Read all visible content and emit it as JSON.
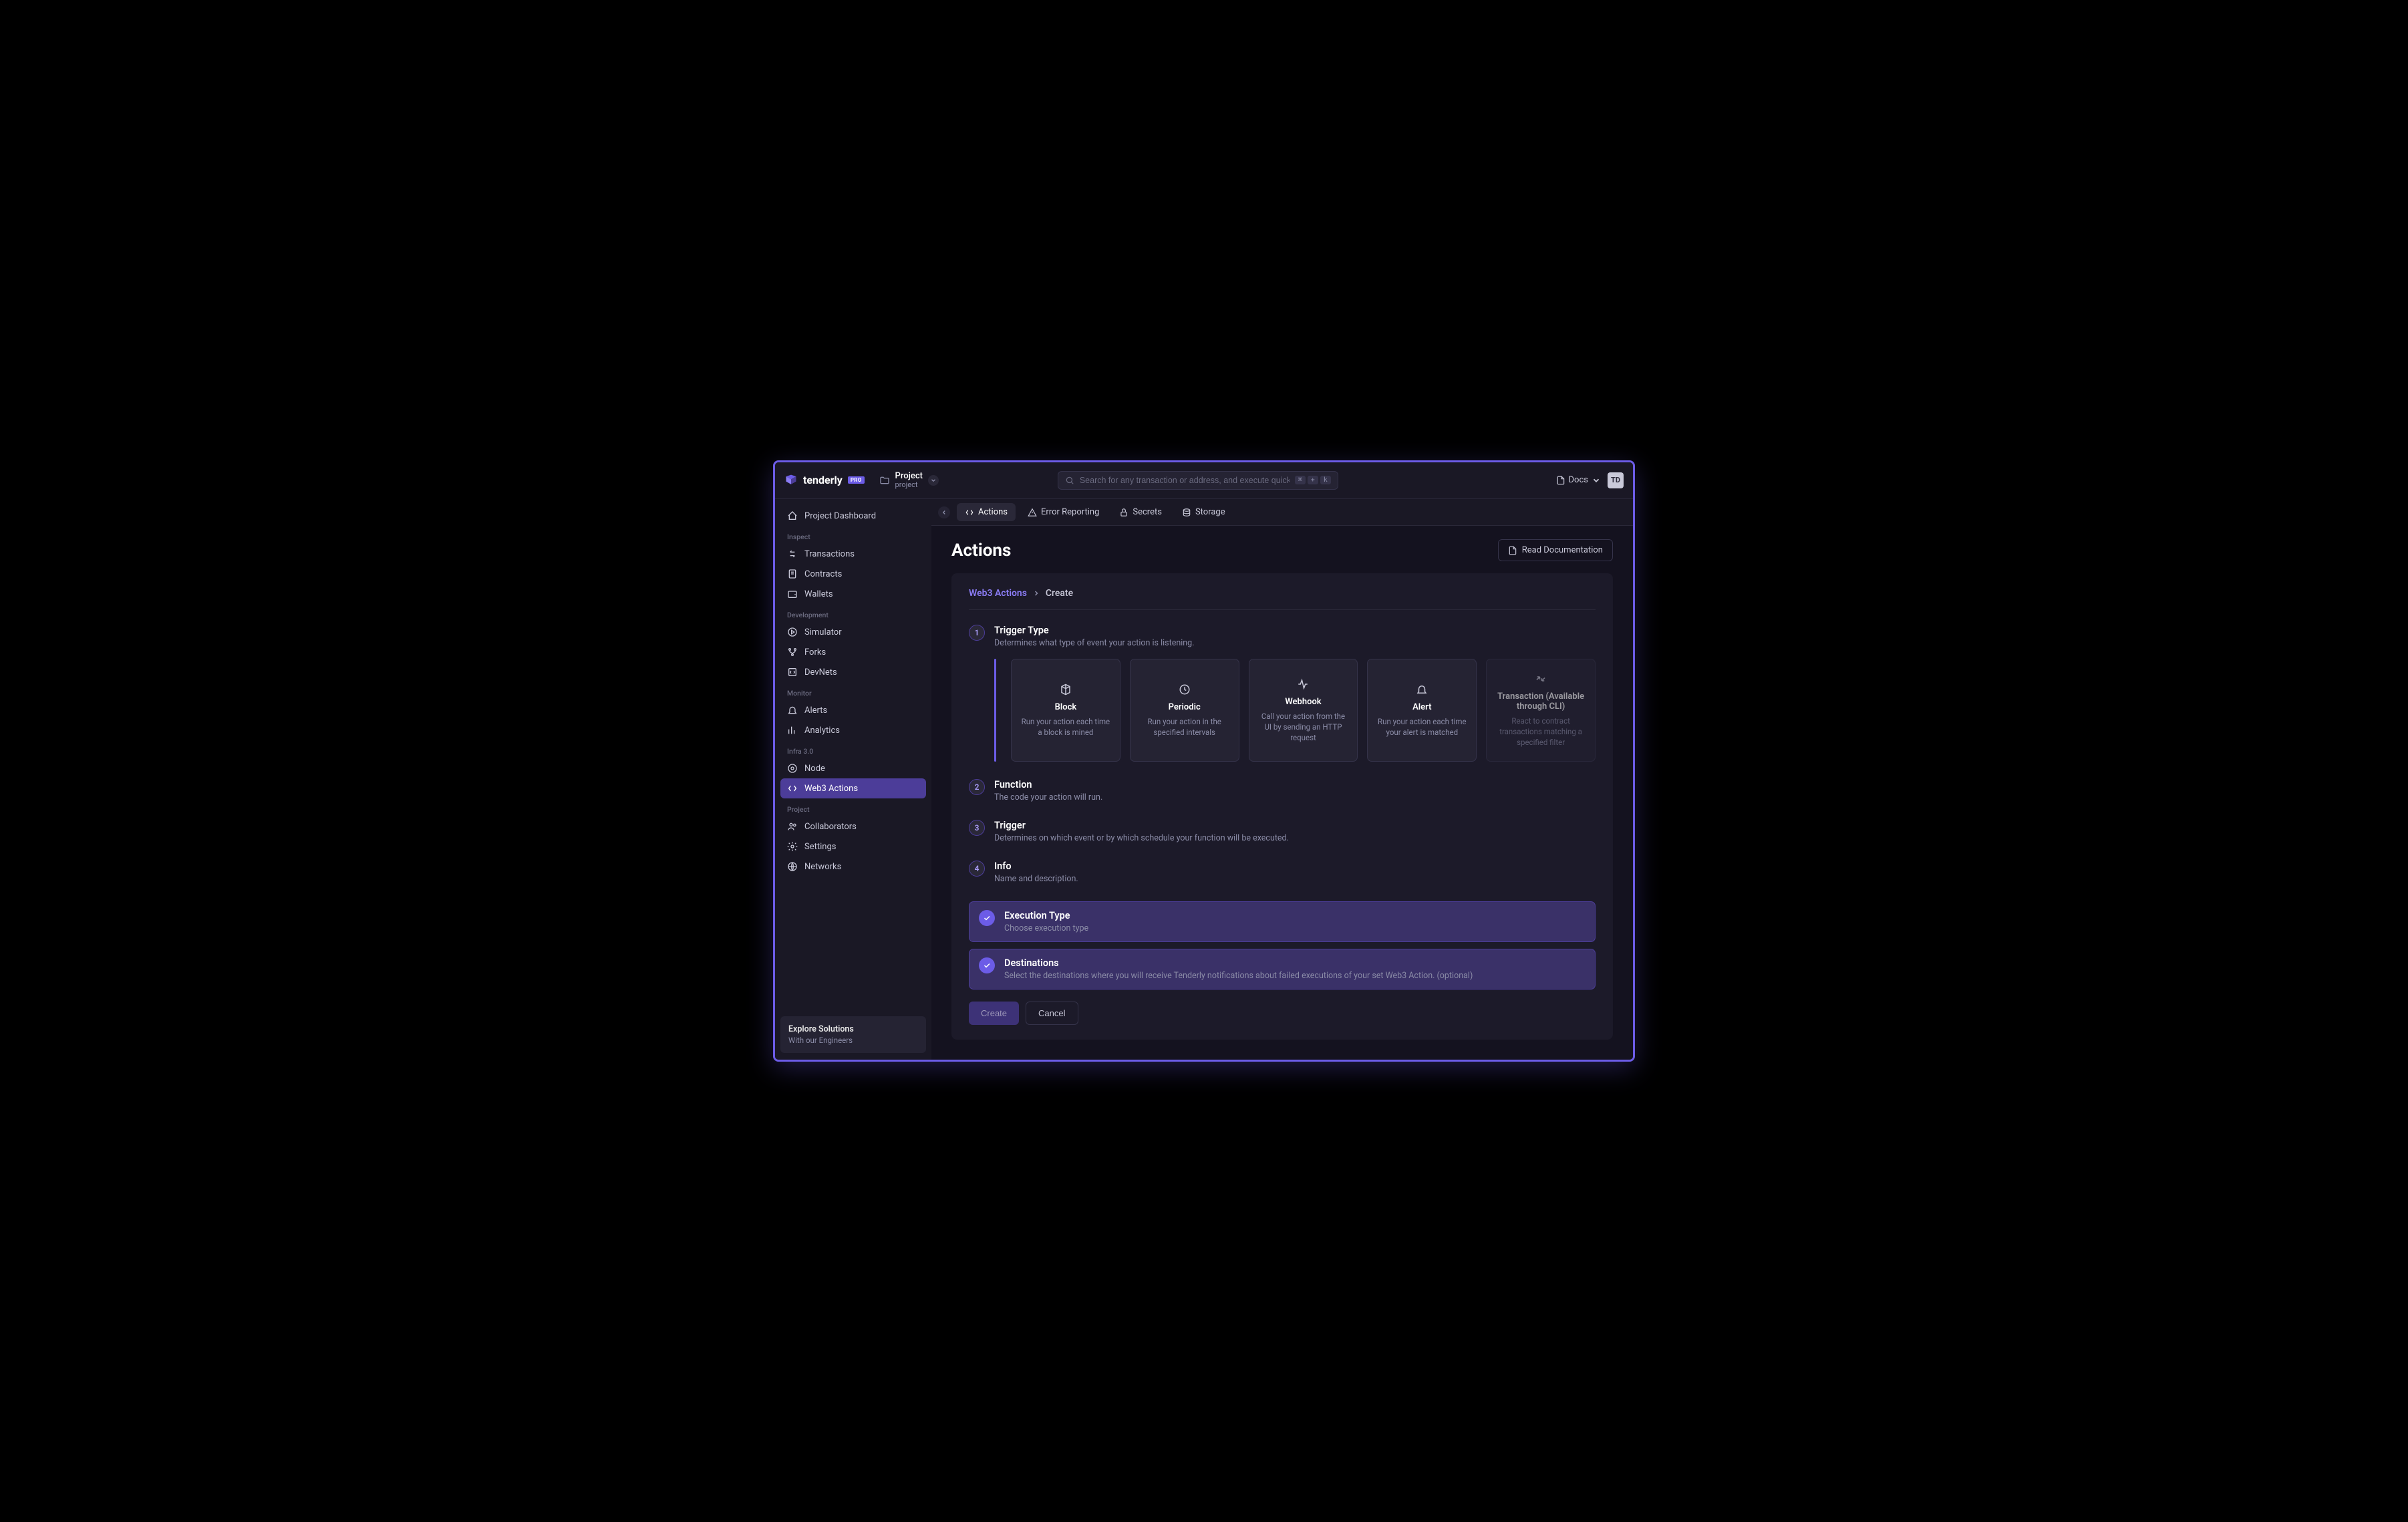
{
  "brand": {
    "name": "tenderly",
    "badge": "PRO"
  },
  "project_selector": {
    "name": "Project",
    "subtitle": "project"
  },
  "search": {
    "placeholder": "Search for any transaction or address, and execute quick comma...",
    "kbd": [
      "⌘",
      "+",
      "k"
    ]
  },
  "top": {
    "docs": "Docs",
    "avatar": "TD"
  },
  "sidebar": {
    "dashboard": "Project Dashboard",
    "sections": {
      "inspect": {
        "label": "Inspect",
        "items": [
          "Transactions",
          "Contracts",
          "Wallets"
        ]
      },
      "development": {
        "label": "Development",
        "items": [
          "Simulator",
          "Forks",
          "DevNets"
        ]
      },
      "monitor": {
        "label": "Monitor",
        "items": [
          "Alerts",
          "Analytics"
        ]
      },
      "infra": {
        "label": "Infra 3.0",
        "items": [
          "Node",
          "Web3 Actions"
        ]
      },
      "project": {
        "label": "Project",
        "items": [
          "Collaborators",
          "Settings",
          "Networks"
        ]
      }
    },
    "explore": {
      "title": "Explore Solutions",
      "subtitle": "With our Engineers"
    }
  },
  "subnav": {
    "tabs": [
      "Actions",
      "Error Reporting",
      "Secrets",
      "Storage"
    ]
  },
  "page": {
    "title": "Actions",
    "doc_btn": "Read Documentation",
    "breadcrumb": {
      "root": "Web3 Actions",
      "current": "Create"
    },
    "steps": [
      {
        "num": "1",
        "title": "Trigger Type",
        "desc": "Determines what type of event your action is listening."
      },
      {
        "num": "2",
        "title": "Function",
        "desc": "The code your action will run."
      },
      {
        "num": "3",
        "title": "Trigger",
        "desc": "Determines on which event or by which schedule your function will be executed."
      },
      {
        "num": "4",
        "title": "Info",
        "desc": "Name and description."
      }
    ],
    "triggers": [
      {
        "title": "Block",
        "desc": "Run your action each time a block is mined"
      },
      {
        "title": "Periodic",
        "desc": "Run your action in the specified intervals"
      },
      {
        "title": "Webhook",
        "desc": "Call your action from the UI by sending an HTTP request"
      },
      {
        "title": "Alert",
        "desc": "Run your action each time your alert is matched"
      },
      {
        "title": "Transaction (Available through CLI)",
        "desc": "React to contract transactions matching a specified filter"
      }
    ],
    "completed": [
      {
        "title": "Execution Type",
        "desc": "Choose execution type"
      },
      {
        "title": "Destinations",
        "desc": "Select the destinations where you will receive Tenderly notifications about failed executions of your set Web3 Action. (optional)"
      }
    ],
    "buttons": {
      "create": "Create",
      "cancel": "Cancel"
    }
  }
}
